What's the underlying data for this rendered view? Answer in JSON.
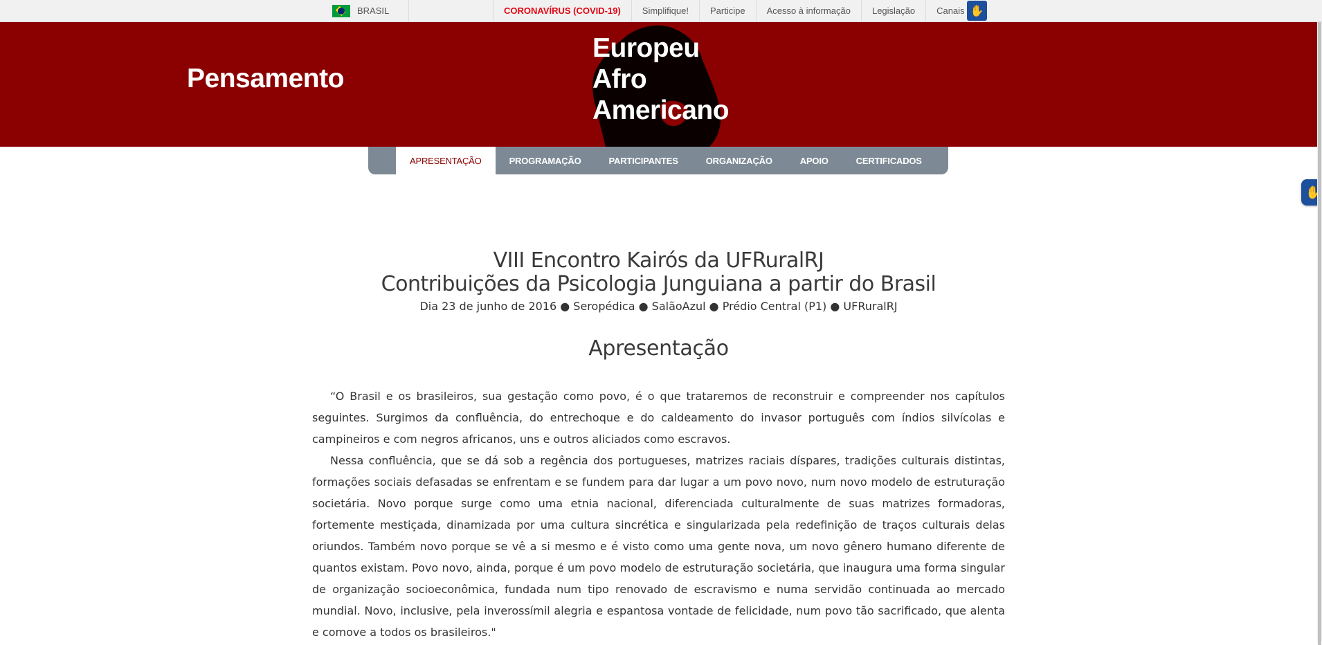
{
  "gov_bar": {
    "country": "BRASIL",
    "links": [
      "CORONAVÍRUS (COVID-19)",
      "Simplifique!",
      "Participe",
      "Acesso à informação",
      "Legislação",
      "Canais"
    ],
    "accessibility_icon": "sign-language-icon"
  },
  "header": {
    "title_left": "Pensamento",
    "title_right_lines": [
      "Europeu",
      "Afro",
      "Americano"
    ],
    "background_color": "#8b0000"
  },
  "nav": {
    "items": [
      "APRESENTAÇÃO",
      "PROGRAMAÇÃO",
      "PARTICIPANTES",
      "ORGANIZAÇÃO",
      "APOIO",
      "CERTIFICADOS"
    ],
    "active": "APRESENTAÇÃO"
  },
  "content": {
    "event_title_line1": "VIII Encontro Kairós da UFRuralRJ",
    "event_title_line2": "Contribuições da Psicologia Junguiana a partir do Brasil",
    "event_details": "Dia 23 de junho de 2016 ● Seropédica ● SalãoAzul ● Prédio Central (P1) ● UFRuralRJ",
    "section_title": "Apresentação",
    "paragraphs": [
      "“O Brasil e os brasileiros, sua gestação como povo, é o que trataremos de reconstruir e compreender nos capítulos seguintes. Surgimos da confluência, do entrechoque e do caldeamento do invasor português com índios silvícolas e campineiros e com negros africanos, uns e outros aliciados como escravos.",
      "Nessa confluência, que se dá sob a regência dos portugueses, matrizes raciais díspares, tradições culturais distintas, formações sociais defasadas se enfrentam e se fundem para dar lugar a um povo novo, num novo modelo de estruturação societária. Novo porque surge como uma etnia nacional, diferenciada culturalmente de suas matrizes formadoras, fortemente mestiçada, dinamizada por uma cultura sincrética e singularizada pela redefinição de traços culturais delas oriundos. Também novo porque se vê a si mesmo e é visto como uma gente nova, um novo gênero humano diferente de quantos existam. Povo novo, ainda, porque é um povo modelo de estruturação societária, que inaugura uma forma singular de organização socioeconômica, fundada num tipo renovado de escravismo e numa servidão continuada ao mercado mundial. Novo, inclusive, pela inverossímil alegria e espantosa vontade de felicidade, num povo tão sacrificado, que alenta e comove a todos os brasileiros.\""
    ]
  },
  "floating_widget": {
    "icon": "sign-language-icon"
  }
}
